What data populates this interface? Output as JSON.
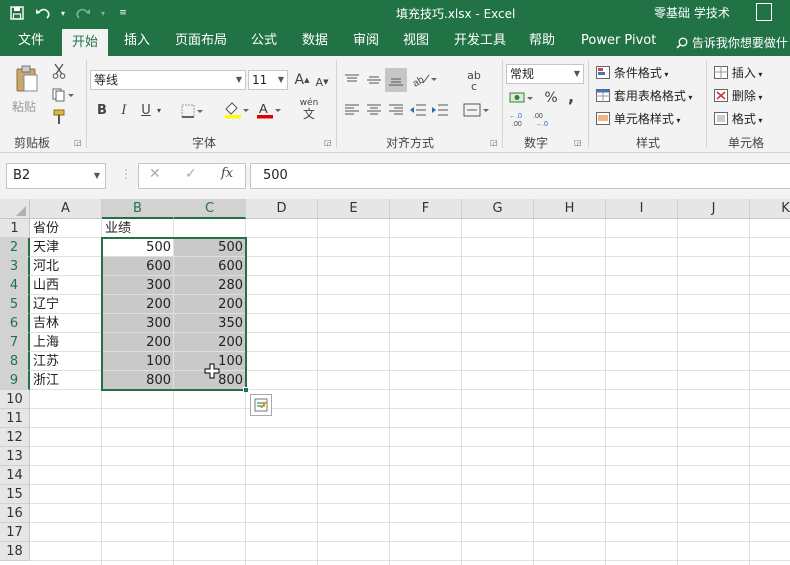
{
  "titlebar": {
    "title": "填充技巧.xlsx  -  Excel",
    "user": "零基础 学技术"
  },
  "tabs": [
    "文件",
    "开始",
    "插入",
    "页面布局",
    "公式",
    "数据",
    "审阅",
    "视图",
    "开发工具",
    "帮助",
    "Power Pivot"
  ],
  "active_tab": "开始",
  "tell_me": "告诉我你想要做什",
  "ribbon": {
    "clipboard": {
      "paste": "粘贴",
      "label": "剪贴板"
    },
    "font": {
      "name": "等线",
      "size": "11",
      "label": "字体",
      "bold": "B",
      "italic": "I",
      "underline": "U",
      "grow": "A",
      "shrink": "A",
      "wen": "wén",
      "wen_char": "文"
    },
    "alignment": {
      "label": "对齐方式",
      "ab": "ab",
      "c": "c"
    },
    "number": {
      "format": "常规",
      "percent": "%",
      "comma": ",",
      "label": "数字"
    },
    "styles": {
      "conditional": "条件格式",
      "table": "套用表格格式",
      "cell": "单元格样式",
      "label": "样式"
    },
    "cells": {
      "insert": "插入",
      "delete": "删除",
      "format": "格式",
      "label": "单元格"
    }
  },
  "formula_bar": {
    "name_box": "B2",
    "cancel": "✕",
    "enter": "✓",
    "fx": "fx",
    "value": "500"
  },
  "grid": {
    "columns": [
      "A",
      "B",
      "C",
      "D",
      "E",
      "F",
      "G",
      "H",
      "I",
      "J",
      "K"
    ],
    "rows": [
      "1",
      "2",
      "3",
      "4",
      "5",
      "6",
      "7",
      "8",
      "9",
      "10",
      "11",
      "12",
      "13",
      "14",
      "15",
      "16",
      "17",
      "18"
    ],
    "selected_columns": [
      "B",
      "C"
    ],
    "selected_rows": [
      "2",
      "3",
      "4",
      "5",
      "6",
      "7",
      "8",
      "9"
    ],
    "header_a": "省份",
    "header_b": "业绩",
    "data": [
      {
        "province": "天津",
        "b": "500",
        "c": "500"
      },
      {
        "province": "河北",
        "b": "600",
        "c": "600"
      },
      {
        "province": "山西",
        "b": "300",
        "c": "280"
      },
      {
        "province": "辽宁",
        "b": "200",
        "c": "200"
      },
      {
        "province": "吉林",
        "b": "300",
        "c": "350"
      },
      {
        "province": "上海",
        "b": "200",
        "c": "200"
      },
      {
        "province": "江苏",
        "b": "100",
        "c": "100"
      },
      {
        "province": "浙江",
        "b": "800",
        "c": "800"
      }
    ]
  },
  "colors": {
    "brand": "#217346",
    "selection": "#c9c9c9"
  }
}
